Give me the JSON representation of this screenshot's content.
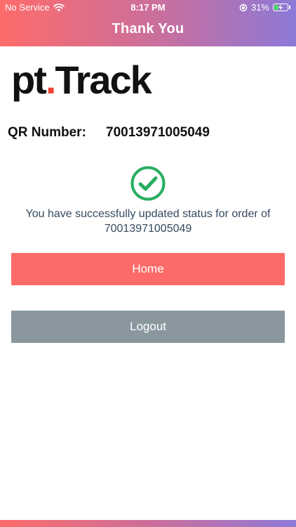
{
  "status_bar": {
    "carrier": "No Service",
    "time": "8:17 PM",
    "battery_percent": "31%",
    "battery_level": 0.31,
    "icons": [
      "wifi-icon",
      "orientation-lock-icon",
      "battery-charging-icon"
    ]
  },
  "header": {
    "title": "Thank You"
  },
  "logo": {
    "part1": "pt",
    "dot": ".",
    "part2": "Track"
  },
  "qr": {
    "label": "QR Number:",
    "value": "70013971005049"
  },
  "success": {
    "icon": "check-circle-icon",
    "message_line1": "You have successfully updated status for order of",
    "message_line2": "70013971005049"
  },
  "buttons": {
    "home_label": "Home",
    "logout_label": "Logout"
  },
  "colors": {
    "gradient_start": "#fd6c6a",
    "gradient_end": "#8c79d8",
    "home_button": "#fd6b69",
    "logout_button": "#8a979f",
    "success_green": "#27ae60",
    "logo_dot": "#ef4536"
  }
}
